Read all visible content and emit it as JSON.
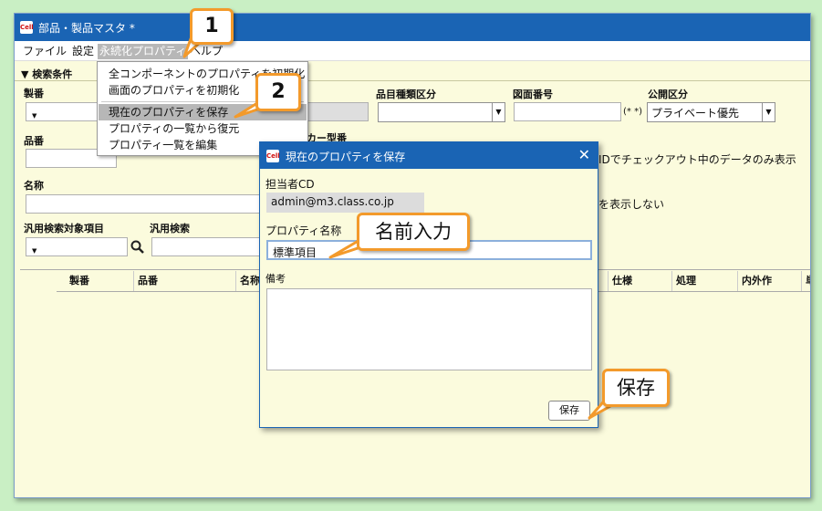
{
  "app": {
    "logo": "Cell",
    "title": "部品・製品マスタ *",
    "menu": [
      "ファイル",
      "設定",
      "永続化プロパティ",
      "ヘルプ"
    ]
  },
  "search": {
    "header": "▼ 検索条件",
    "seiban": "製番",
    "hinban": "品番",
    "maker_hinban": "カー型番",
    "name": "名称",
    "hinmoku": "品目種類区分",
    "zumen": "図面番号",
    "zumen_note": "(* *)",
    "koukai": "公開区分",
    "koukai_value": "プライベート優先",
    "checkout_note": "IDでチェックアウト中のデータのみ表示",
    "hide_note": "を表示しない",
    "hanyou_item": "汎用検索対象項目",
    "hanyou": "汎用検索"
  },
  "grid": {
    "columns": [
      "製番",
      "品番",
      "名称",
      "仕様",
      "処理",
      "内外作",
      "単"
    ]
  },
  "dropdown": {
    "items": [
      "全コンポーネントのプロパティを初期化",
      "画面のプロパティを初期化",
      "現在のプロパティを保存",
      "プロパティの一覧から復元",
      "プロパティ一覧を編集"
    ]
  },
  "dialog": {
    "title": "現在のプロパティを保存",
    "user_label": "担当者CD",
    "user_value": "admin@m3.class.co.jp",
    "name_label": "プロパティ名称",
    "name_value": "標準項目",
    "note_label": "備考",
    "save": "保存"
  },
  "callouts": {
    "step1": "1",
    "step2": "2",
    "name_input": "名前入力",
    "save": "保存"
  },
  "colors": {
    "titlebar": "#1a64b4",
    "background": "#c9efc4",
    "panel": "#fbfbdd",
    "callout_border": "#f39a2b"
  }
}
